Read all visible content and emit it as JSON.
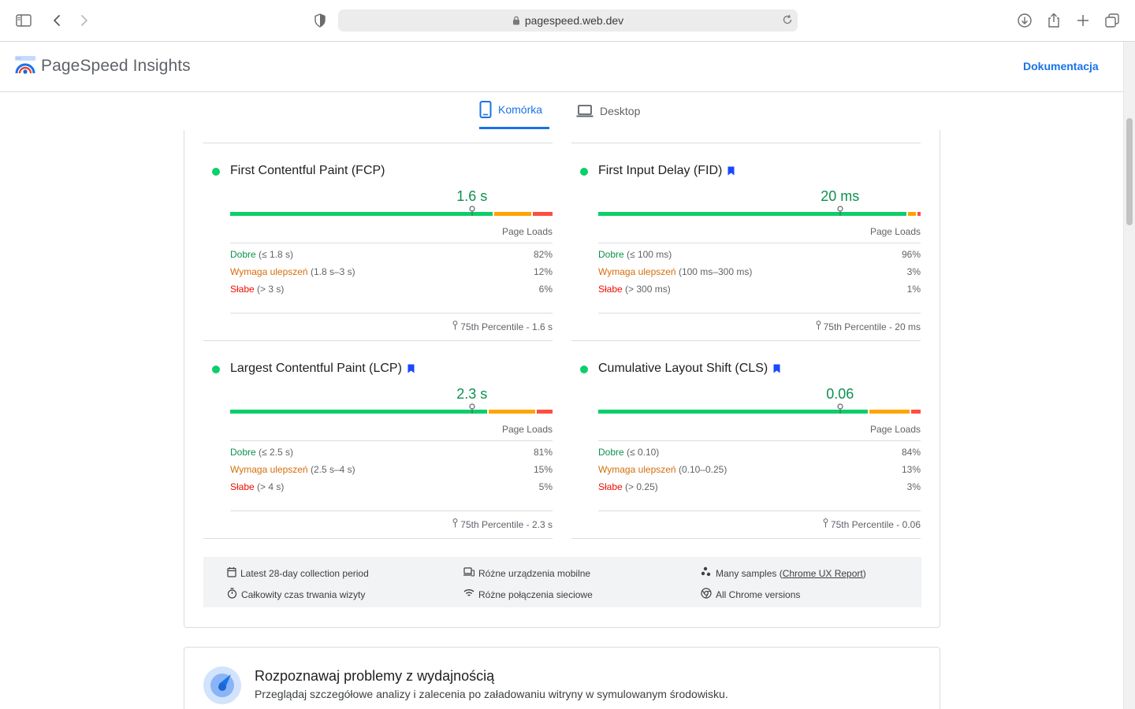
{
  "browser": {
    "url": "pagespeed.web.dev"
  },
  "header": {
    "app_title": "PageSpeed Insights",
    "docs_label": "Dokumentacja"
  },
  "tabs": [
    {
      "label": "Komórka",
      "active": true
    },
    {
      "label": "Desktop",
      "active": false
    }
  ],
  "colors": {
    "good": "#0cce6b",
    "average": "#ffa400",
    "poor": "#ff4e42",
    "accent": "#1a73e8"
  },
  "metrics": [
    {
      "title": "First Contentful Paint (FCP)",
      "bookmark": false,
      "value": "1.6 s",
      "marker_fraction": 0.75,
      "distribution": {
        "good": 82,
        "average": 12,
        "poor": 6
      },
      "column_label": "Page Loads",
      "rows": [
        {
          "label": "Dobre",
          "range": "(≤ 1.8 s)",
          "pct": "82%"
        },
        {
          "label": "Wymaga ulepszeń",
          "range": "(1.8 s–3 s)",
          "pct": "12%"
        },
        {
          "label": "Słabe",
          "range": "(> 3 s)",
          "pct": "6%"
        }
      ],
      "percentile": "75th Percentile - 1.6 s"
    },
    {
      "title": "First Input Delay (FID)",
      "bookmark": true,
      "value": "20 ms",
      "marker_fraction": 0.75,
      "distribution": {
        "good": 96,
        "average": 3,
        "poor": 1
      },
      "column_label": "Page Loads",
      "rows": [
        {
          "label": "Dobre",
          "range": "(≤ 100 ms)",
          "pct": "96%"
        },
        {
          "label": "Wymaga ulepszeń",
          "range": "(100 ms–300 ms)",
          "pct": "3%"
        },
        {
          "label": "Słabe",
          "range": "(> 300 ms)",
          "pct": "1%"
        }
      ],
      "percentile": "75th Percentile - 20 ms"
    },
    {
      "title": "Largest Contentful Paint (LCP)",
      "bookmark": true,
      "value": "2.3 s",
      "marker_fraction": 0.75,
      "distribution": {
        "good": 81,
        "average": 15,
        "poor": 5
      },
      "column_label": "Page Loads",
      "rows": [
        {
          "label": "Dobre",
          "range": "(≤ 2.5 s)",
          "pct": "81%"
        },
        {
          "label": "Wymaga ulepszeń",
          "range": "(2.5 s–4 s)",
          "pct": "15%"
        },
        {
          "label": "Słabe",
          "range": "(> 4 s)",
          "pct": "5%"
        }
      ],
      "percentile": "75th Percentile - 2.3 s"
    },
    {
      "title": "Cumulative Layout Shift (CLS)",
      "bookmark": true,
      "value": "0.06",
      "marker_fraction": 0.75,
      "distribution": {
        "good": 84,
        "average": 13,
        "poor": 3
      },
      "column_label": "Page Loads",
      "rows": [
        {
          "label": "Dobre",
          "range": "(≤ 0.10)",
          "pct": "84%"
        },
        {
          "label": "Wymaga ulepszeń",
          "range": "(0.10–0.25)",
          "pct": "13%"
        },
        {
          "label": "Słabe",
          "range": "(> 0.25)",
          "pct": "3%"
        }
      ],
      "percentile": "75th Percentile - 0.06"
    }
  ],
  "info": {
    "period": "Latest 28-day collection period",
    "devices": "Różne urządzenia mobilne",
    "samples_prefix": "Many samples (",
    "samples_link": "Chrome UX Report",
    "samples_suffix": ")",
    "duration": "Całkowity czas trwania wizyty",
    "network": "Różne połączenia sieciowe",
    "chrome": "All Chrome versions"
  },
  "diagnose": {
    "title": "Rozpoznawaj problemy z wydajnością",
    "subtitle": "Przeglądaj szczegółowe analizy i zalecenia po załadowaniu witryny w symulowanym środowisku."
  }
}
